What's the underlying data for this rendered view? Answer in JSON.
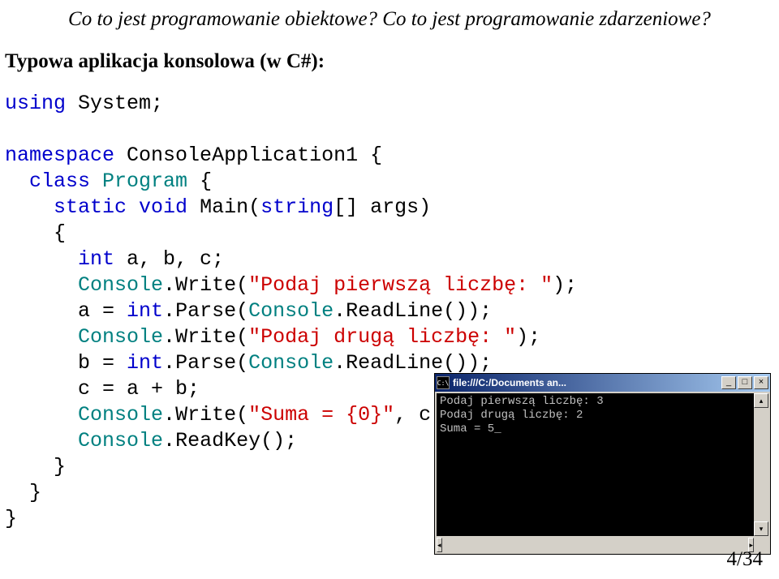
{
  "header": "Co to jest programowanie obiektowe? Co to jest programowanie zdarzeniowe?",
  "subhead": "Typowa aplikacja konsolowa (w C#):",
  "code": {
    "kw_using": "using",
    "sys": "System",
    "kw_namespace": "namespace",
    "ns": "ConsoleApplication1",
    "kw_class": "class",
    "cls": "Program",
    "kw_static": "static",
    "kw_void": "void",
    "fn": "Main",
    "kw_string": "string",
    "args": "args",
    "kw_int": "int",
    "vars": "a, b, c",
    "console": "Console",
    "write": "Write",
    "str1": "\"Podaj pierwszą liczbę: \"",
    "int_t": "int",
    "parse": "Parse",
    "readline": "ReadLine",
    "str2": "\"Podaj drugą liczbę: \"",
    "str3": "\"Suma = {0}\"",
    "readkey": "ReadKey"
  },
  "console_window": {
    "icon_text": "C:\\",
    "title": "file:///C:/Documents an...",
    "min": "_",
    "max": "□",
    "close": "×",
    "output": "Podaj pierwszą liczbę: 3\nPodaj drugą liczbę: 2\nSuma = 5_",
    "up": "▴",
    "down": "▾",
    "left": "◂",
    "right": "▸"
  },
  "pager": "4/34"
}
